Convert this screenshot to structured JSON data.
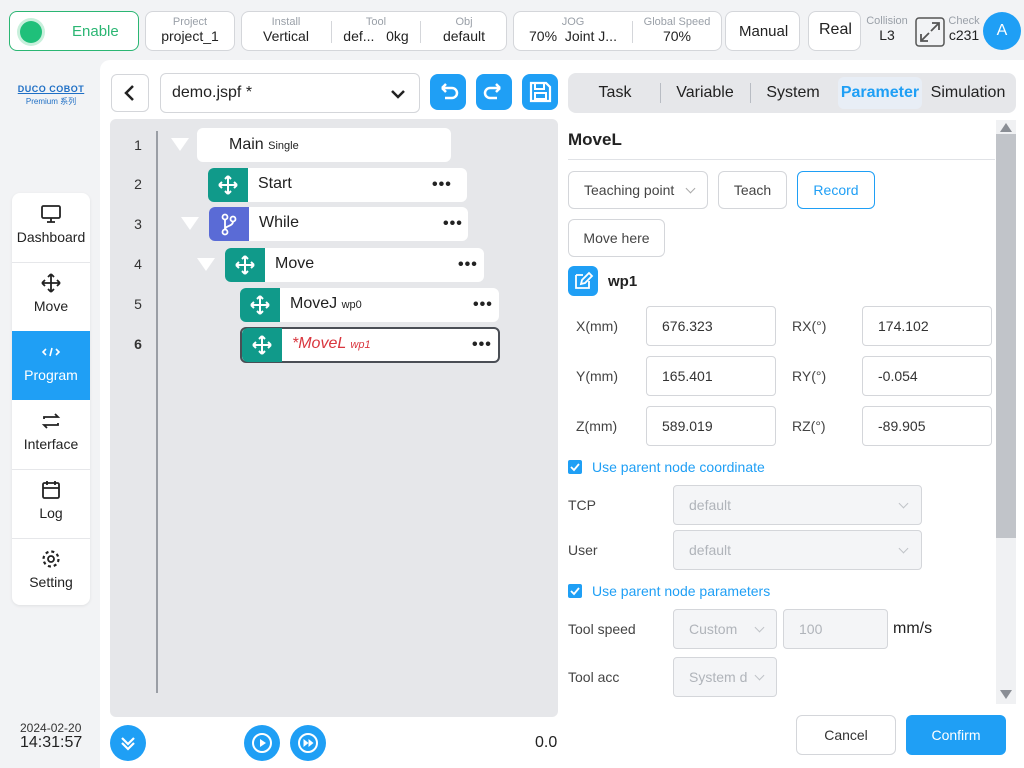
{
  "topbar": {
    "enable_label": "Enable",
    "project": {
      "label": "Project",
      "value": "project_1"
    },
    "install": {
      "label": "Install",
      "value": "Vertical"
    },
    "tool": {
      "label": "Tool",
      "value": "def...",
      "value2": "0kg"
    },
    "obj": {
      "label": "Obj",
      "value": "default"
    },
    "jog": {
      "label": "JOG",
      "value": "70%",
      "value2": "Joint J..."
    },
    "speed": {
      "label": "Global Speed",
      "value": "70%"
    },
    "mode": "Manual",
    "real": "Real",
    "collision": {
      "label": "Collision",
      "value": "L3"
    },
    "check": {
      "label": "Check",
      "value": "c231"
    },
    "avatar": "A"
  },
  "brand": {
    "name": "DUCO COBOT",
    "sub": "Premium 系列"
  },
  "sidebar": {
    "items": [
      {
        "label": "Dashboard",
        "icon": "monitor-icon"
      },
      {
        "label": "Move",
        "icon": "move-icon"
      },
      {
        "label": "Program",
        "icon": "code-icon"
      },
      {
        "label": "Interface",
        "icon": "exchange-icon"
      },
      {
        "label": "Log",
        "icon": "calendar-icon"
      },
      {
        "label": "Setting",
        "icon": "gear-icon"
      }
    ],
    "active": "Program",
    "date": "2024-02-20",
    "time": "14:31:57"
  },
  "editor": {
    "file": "demo.jspf *",
    "lines": [
      "1",
      "2",
      "3",
      "4",
      "5",
      "6"
    ],
    "nodes": {
      "main": {
        "name": "Main",
        "tag": "Single"
      },
      "start": {
        "name": "Start"
      },
      "while": {
        "name": "While"
      },
      "move": {
        "name": "Move"
      },
      "movej": {
        "name": "MoveJ",
        "tag": "wp0"
      },
      "movel": {
        "name": "*MoveL",
        "tag": "wp1"
      }
    },
    "dots": "•••",
    "progress_value": "0.0"
  },
  "tabs": [
    "Task",
    "Variable",
    "System",
    "Parameter",
    "Simulation"
  ],
  "active_tab": "Parameter",
  "param": {
    "title": "MoveL",
    "teaching_point": "Teaching point",
    "teach": "Teach",
    "record": "Record",
    "move_here": "Move here",
    "waypoint": "wp1",
    "x_label": "X(mm)",
    "x": "676.323",
    "y_label": "Y(mm)",
    "y": "165.401",
    "z_label": "Z(mm)",
    "z": "589.019",
    "rx_label": "RX(°)",
    "rx": "174.102",
    "ry_label": "RY(°)",
    "ry": "-0.054",
    "rz_label": "RZ(°)",
    "rz": "-89.905",
    "use_parent_coord": "Use parent node coordinate",
    "tcp_label": "TCP",
    "tcp": "default",
    "user_label": "User",
    "user": "default",
    "use_parent_params": "Use parent node parameters",
    "tool_speed_label": "Tool speed",
    "tool_speed_mode": "Custom",
    "tool_speed_value": "100",
    "tool_speed_unit": "mm/s",
    "tool_acc_label": "Tool acc",
    "tool_acc_mode": "System d"
  },
  "footer": {
    "cancel": "Cancel",
    "confirm": "Confirm"
  },
  "colors": {
    "accent": "#1f9ff5",
    "teal": "#109a8a",
    "purple": "#5a6bd6",
    "enable_green": "#2bb673",
    "error_red": "#d9363e"
  }
}
